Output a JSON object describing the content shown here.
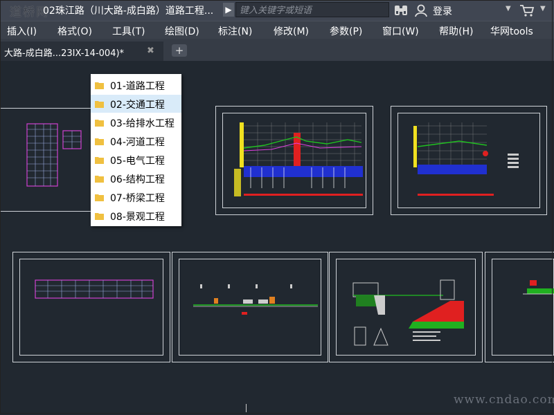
{
  "titlebar": {
    "logo_text": "道桥网",
    "doc_title": "02珠江路（川大路-成白路）道路工程...",
    "search_placeholder": "键入关键字或短语",
    "login_label": "登录",
    "icons": [
      "binoculars-icon",
      "user-icon",
      "cart-icon"
    ]
  },
  "menubar": {
    "items": [
      "插入(I)",
      "格式(O)",
      "工具(T)",
      "绘图(D)",
      "标注(N)",
      "修改(M)",
      "参数(P)",
      "窗口(W)",
      "帮助(H)",
      "华网tools"
    ]
  },
  "tabbar": {
    "tab_label": "大路-成白路...23IX-14-004)*",
    "close_glyph": "✖",
    "add_glyph": "+"
  },
  "folder_menu": {
    "selected_index": 1,
    "items": [
      "01-道路工程",
      "02-交通工程",
      "03-给排水工程",
      "04-河道工程",
      "05-电气工程",
      "06-结构工程",
      "07-桥梁工程",
      "08-景观工程"
    ]
  },
  "watermark": "www.cndao.com",
  "colors": {
    "canvas_bg": "#212830",
    "title_bg": "#404652",
    "menu_bg": "#3b414b",
    "folder_yellow": "#f0c040",
    "selection": "#d9ebf9"
  }
}
